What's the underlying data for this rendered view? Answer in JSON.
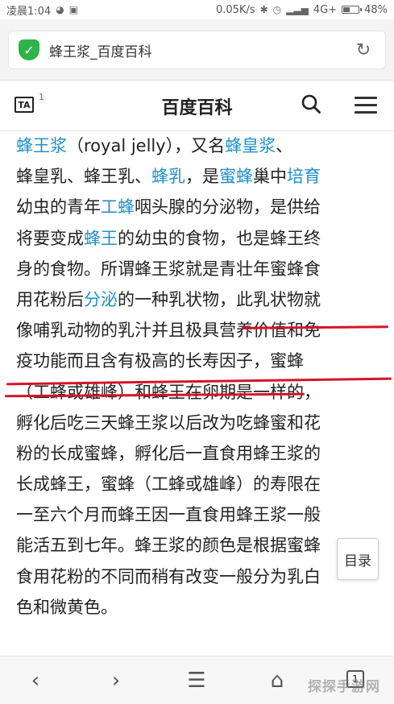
{
  "status_bar": {
    "time": "凌晨1:04",
    "speed": "0.05K/s",
    "network": "4G+",
    "battery": "48%",
    "battery_level": 0.48
  },
  "address_bar": {
    "page_title": "蜂王浆_百度百科"
  },
  "site_header": {
    "title": "百度百科",
    "notification_count": "1",
    "logo_text": "TA"
  },
  "article": {
    "lines": [
      [
        {
          "t": "蜂王浆",
          "l": true
        },
        {
          "t": "（royal jelly），又名"
        },
        {
          "t": "蜂皇浆",
          "l": true
        },
        {
          "t": "、"
        }
      ],
      [
        {
          "t": "蜂皇乳、蜂王乳、"
        },
        {
          "t": "蜂乳",
          "l": true
        },
        {
          "t": "，是"
        },
        {
          "t": "蜜蜂",
          "l": true
        },
        {
          "t": "巢中"
        },
        {
          "t": "培育",
          "l": true
        }
      ],
      [
        {
          "t": "幼虫的青年"
        },
        {
          "t": "工蜂",
          "l": true
        },
        {
          "t": "咽头腺的分泌物，是供给"
        }
      ],
      [
        {
          "t": "将要变成"
        },
        {
          "t": "蜂王",
          "l": true
        },
        {
          "t": "的幼虫的食物，也是蜂王终"
        }
      ],
      [
        {
          "t": "身的食物。所谓蜂王浆就是青壮年蜜蜂食"
        }
      ],
      [
        {
          "t": "用花粉后"
        },
        {
          "t": "分泌",
          "l": true
        },
        {
          "t": "的一种乳状物，此乳状物就"
        }
      ],
      [
        {
          "t": "像哺乳动物的乳汁并且极具营养价值和免"
        }
      ],
      [
        {
          "t": "疫功能而且含有极高的长寿因子，蜜蜂"
        }
      ],
      [
        {
          "t": "（工蜂或雄峰）和蜂王在卵期是一样的，"
        }
      ],
      [
        {
          "t": "孵化后吃三天蜂王浆以后改为吃蜂蜜和花"
        }
      ],
      [
        {
          "t": "粉的长成蜜蜂，孵化后一直食用蜂王浆的"
        }
      ],
      [
        {
          "t": "长成蜂王，蜜蜂（工蜂或雄峰）的寿限在"
        }
      ],
      [
        {
          "t": "一至六个月而蜂王因一直食用蜂王浆一般"
        }
      ],
      [
        {
          "t": "能活五到七年。蜂王浆的颜色是根据蜜蜂"
        }
      ],
      [
        {
          "t": "食用花粉的不同而稍有改变一般分为乳白"
        }
      ],
      [
        {
          "t": "色和微黄色。"
        }
      ]
    ]
  },
  "toc_button": {
    "label": "目录"
  },
  "bottom_nav": {
    "tabs_count": "1"
  },
  "watermark": {
    "text": "探探手游网"
  },
  "colors": {
    "link": "#1e90c9",
    "underline": "#d6132a",
    "shield": "#2db34a"
  }
}
